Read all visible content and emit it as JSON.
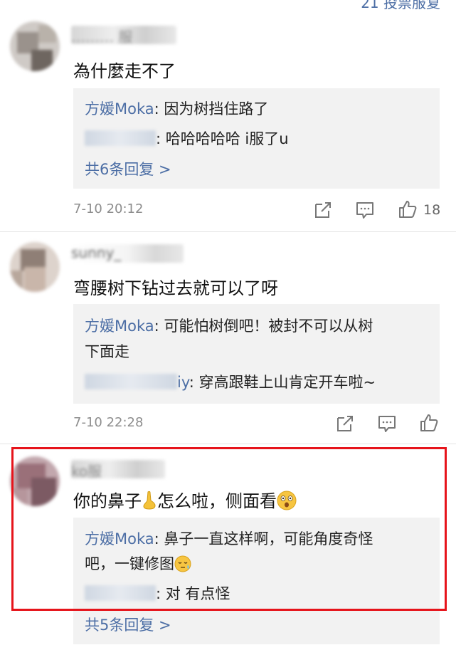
{
  "header": {
    "more_link": "21 投票服复"
  },
  "comments": [
    {
      "username": "……… 服",
      "text": "為什麼走不了",
      "replies": [
        {
          "author": "方媛Moka",
          "text": ": 因为树挡住路了"
        },
        {
          "author": "",
          "author_suffix": "",
          "text": ": 哈哈哈哈哈 i服了u"
        }
      ],
      "more_replies": "共6条回复 >",
      "time": "7-10 20:12",
      "like_count": "18"
    },
    {
      "username": "sunny_",
      "text": "弯腰树下钻过去就可以了呀",
      "replies": [
        {
          "author": "方媛Moka",
          "text": ": 可能怕树倒吧！被封不可以从树",
          "text_cont": "下面走"
        },
        {
          "author": "",
          "author_suffix": "iy",
          "text": ": 穿高跟鞋上山肯定开车啦~"
        }
      ],
      "time": "7-10 22:28",
      "like_count": ""
    },
    {
      "username": "ko服",
      "text_before": "你的鼻子",
      "text_after": "怎么啦，侧面看",
      "replies": [
        {
          "author": "方媛Moka",
          "text": ": 鼻子一直这样啊，可能角度奇怪",
          "text_cont": "吧，一键修图"
        },
        {
          "author": "",
          "author_suffix": "",
          "text": ": 对 有点怪"
        }
      ],
      "more_replies": "共5条回复 >"
    }
  ],
  "colors": {
    "link": "#4c6ea5",
    "highlight": "#e6141b",
    "reply_bg": "#f2f2f2"
  }
}
